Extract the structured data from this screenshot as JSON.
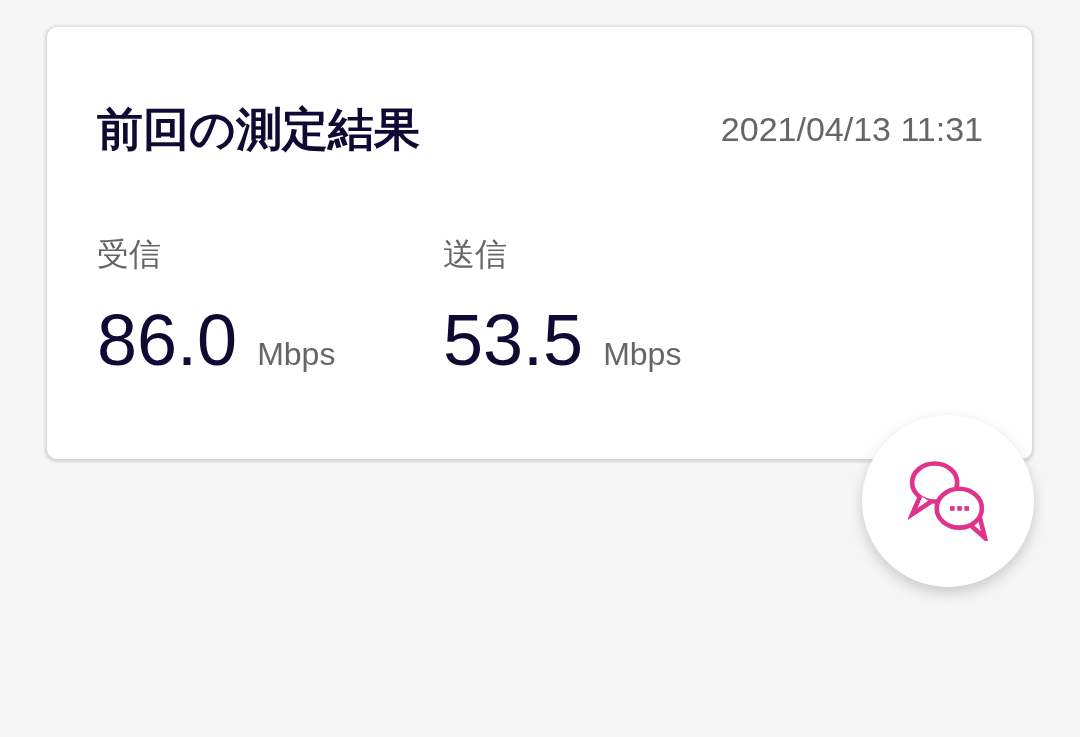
{
  "card": {
    "title": "前回の測定結果",
    "timestamp": "2021/04/13 11:31",
    "results": [
      {
        "label": "受信",
        "value": "86.0",
        "unit": "Mbps"
      },
      {
        "label": "送信",
        "value": "53.5",
        "unit": "Mbps"
      }
    ]
  }
}
